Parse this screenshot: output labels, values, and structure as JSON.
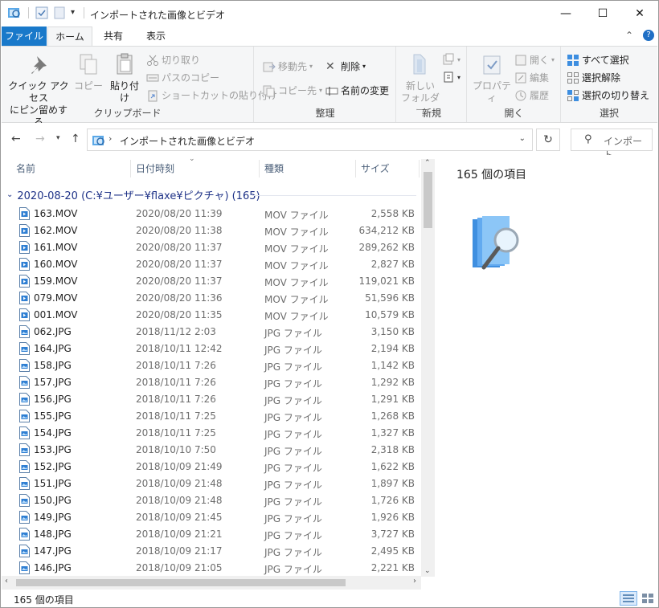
{
  "window": {
    "title": "インポートされた画像とビデオ",
    "controls": {
      "minimize": "—",
      "maximize": "☐",
      "close": "✕"
    }
  },
  "ribbon_tabs": [
    "ファイル",
    "ホーム",
    "共有",
    "表示"
  ],
  "ribbon_right": {
    "collapse": "⌃",
    "help": "?"
  },
  "ribbon": {
    "clipboard": {
      "label": "クリップボード",
      "pin_line1": "クイック アクセス",
      "pin_line2": "にピン留めする",
      "copy": "コピー",
      "paste": "貼り付け",
      "cut": "切り取り",
      "copy_path": "パスのコピー",
      "paste_shortcut": "ショートカットの貼り付け"
    },
    "organize": {
      "label": "整理",
      "move_to": "移動先",
      "copy_to": "コピー先",
      "delete": "削除",
      "rename": "名前の変更"
    },
    "new": {
      "label": "新規",
      "new_folder_line1": "新しい",
      "new_folder_line2": "フォルダー"
    },
    "open": {
      "label": "開く",
      "properties": "プロパティ",
      "open": "開く",
      "edit": "編集",
      "history": "履歴"
    },
    "select": {
      "label": "選択",
      "select_all": "すべて選択",
      "select_none": "選択解除",
      "invert": "選択の切り替え"
    }
  },
  "nav": {
    "address_path": "インポートされた画像とビデオ",
    "search_placeholder": "インポート..."
  },
  "columns": {
    "name": "名前",
    "date": "日付時刻",
    "type": "種類",
    "size": "サイズ"
  },
  "group_header": "2020-08-20 (C:¥ユーザー¥flaxe¥ピクチャ) (165)",
  "files": [
    {
      "name": "163.MOV",
      "date": "2020/08/20 11:39",
      "type": "MOV ファイル",
      "size": "2,558 KB",
      "kind": "mov"
    },
    {
      "name": "162.MOV",
      "date": "2020/08/20 11:38",
      "type": "MOV ファイル",
      "size": "634,212 KB",
      "kind": "mov"
    },
    {
      "name": "161.MOV",
      "date": "2020/08/20 11:37",
      "type": "MOV ファイル",
      "size": "289,262 KB",
      "kind": "mov"
    },
    {
      "name": "160.MOV",
      "date": "2020/08/20 11:37",
      "type": "MOV ファイル",
      "size": "2,827 KB",
      "kind": "mov"
    },
    {
      "name": "159.MOV",
      "date": "2020/08/20 11:37",
      "type": "MOV ファイル",
      "size": "119,021 KB",
      "kind": "mov"
    },
    {
      "name": "079.MOV",
      "date": "2020/08/20 11:36",
      "type": "MOV ファイル",
      "size": "51,596 KB",
      "kind": "mov"
    },
    {
      "name": "001.MOV",
      "date": "2020/08/20 11:35",
      "type": "MOV ファイル",
      "size": "10,579 KB",
      "kind": "mov"
    },
    {
      "name": "062.JPG",
      "date": "2018/11/12 2:03",
      "type": "JPG ファイル",
      "size": "3,150 KB",
      "kind": "jpg"
    },
    {
      "name": "164.JPG",
      "date": "2018/10/11 12:42",
      "type": "JPG ファイル",
      "size": "2,194 KB",
      "kind": "jpg"
    },
    {
      "name": "158.JPG",
      "date": "2018/10/11 7:26",
      "type": "JPG ファイル",
      "size": "1,142 KB",
      "kind": "jpg"
    },
    {
      "name": "157.JPG",
      "date": "2018/10/11 7:26",
      "type": "JPG ファイル",
      "size": "1,292 KB",
      "kind": "jpg"
    },
    {
      "name": "156.JPG",
      "date": "2018/10/11 7:26",
      "type": "JPG ファイル",
      "size": "1,291 KB",
      "kind": "jpg"
    },
    {
      "name": "155.JPG",
      "date": "2018/10/11 7:25",
      "type": "JPG ファイル",
      "size": "1,268 KB",
      "kind": "jpg"
    },
    {
      "name": "154.JPG",
      "date": "2018/10/11 7:25",
      "type": "JPG ファイル",
      "size": "1,327 KB",
      "kind": "jpg"
    },
    {
      "name": "153.JPG",
      "date": "2018/10/10 7:50",
      "type": "JPG ファイル",
      "size": "2,318 KB",
      "kind": "jpg"
    },
    {
      "name": "152.JPG",
      "date": "2018/10/09 21:49",
      "type": "JPG ファイル",
      "size": "1,622 KB",
      "kind": "jpg"
    },
    {
      "name": "151.JPG",
      "date": "2018/10/09 21:48",
      "type": "JPG ファイル",
      "size": "1,897 KB",
      "kind": "jpg"
    },
    {
      "name": "150.JPG",
      "date": "2018/10/09 21:48",
      "type": "JPG ファイル",
      "size": "1,726 KB",
      "kind": "jpg"
    },
    {
      "name": "149.JPG",
      "date": "2018/10/09 21:45",
      "type": "JPG ファイル",
      "size": "1,926 KB",
      "kind": "jpg"
    },
    {
      "name": "148.JPG",
      "date": "2018/10/09 21:21",
      "type": "JPG ファイル",
      "size": "3,727 KB",
      "kind": "jpg"
    },
    {
      "name": "147.JPG",
      "date": "2018/10/09 21:17",
      "type": "JPG ファイル",
      "size": "2,495 KB",
      "kind": "jpg"
    },
    {
      "name": "146.JPG",
      "date": "2018/10/09 21:05",
      "type": "JPG ファイル",
      "size": "2,221 KB",
      "kind": "jpg"
    }
  ],
  "details_pane": {
    "item_count": "165 個の項目"
  },
  "status_bar": {
    "item_count": "165 個の項目"
  },
  "colors": {
    "file_tab": "#1979ca",
    "group_header": "#1e3287",
    "ribbon_bg": "#f5f6f7"
  }
}
